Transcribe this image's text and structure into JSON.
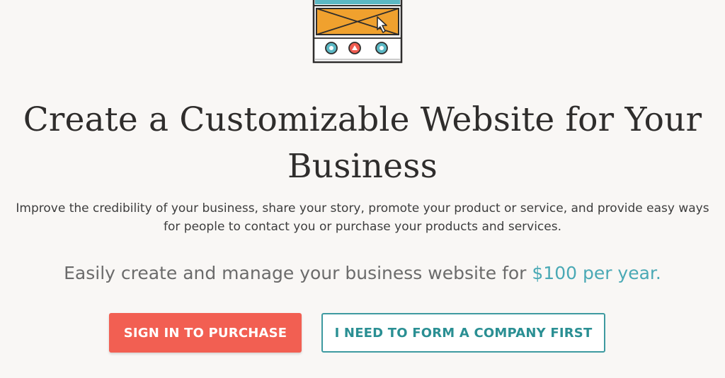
{
  "hero": {
    "headline_line1": "Create a Customizable Website for Your",
    "headline_line2": "Business",
    "subtext_line1": "Improve the credibility of your business, share your story, promote your product or service, and provide easy ways",
    "subtext_line2": "for people to contact you or purchase your products and services.",
    "tagline_prefix": "Easily create and manage your business website for ",
    "tagline_price": "$100 per year."
  },
  "buttons": {
    "primary_label": "SIGN IN TO PURCHASE",
    "secondary_label": "I NEED TO FORM A COMPANY FIRST"
  },
  "illustration": {
    "icon": "website-browser-icon",
    "colors": {
      "orange": "#f0a12e",
      "teal": "#5bb8c4",
      "red": "#ef5a4f",
      "outline": "#2f2d2c"
    }
  },
  "colors": {
    "background": "#f9f7f5",
    "accent_teal": "#4aa9b5",
    "primary_button": "#f25f52"
  }
}
